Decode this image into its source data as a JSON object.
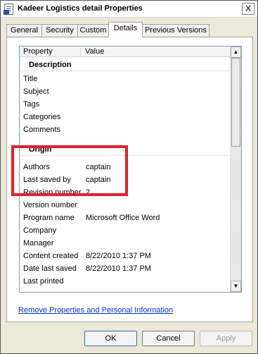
{
  "window": {
    "title": "Kadeer Logistics detail Properties",
    "close_glyph": "X"
  },
  "tabs": [
    {
      "label": "General",
      "active": false
    },
    {
      "label": "Security",
      "active": false
    },
    {
      "label": "Custom",
      "active": false
    },
    {
      "label": "Details",
      "active": true
    },
    {
      "label": "Previous Versions",
      "active": false
    }
  ],
  "grid": {
    "headers": {
      "property": "Property",
      "value": "Value"
    },
    "rows": [
      {
        "type": "section",
        "property": "Description",
        "value": ""
      },
      {
        "type": "item",
        "property": "Title",
        "value": ""
      },
      {
        "type": "item",
        "property": "Subject",
        "value": ""
      },
      {
        "type": "item",
        "property": "Tags",
        "value": ""
      },
      {
        "type": "item",
        "property": "Categories",
        "value": ""
      },
      {
        "type": "item",
        "property": "Comments",
        "value": ""
      },
      {
        "type": "section",
        "property": "Origin",
        "value": ""
      },
      {
        "type": "item",
        "property": "Authors",
        "value": "captain"
      },
      {
        "type": "item",
        "property": "Last saved by",
        "value": "captain"
      },
      {
        "type": "item",
        "property": "Revision number",
        "value": "2"
      },
      {
        "type": "item",
        "property": "Version number",
        "value": ""
      },
      {
        "type": "item",
        "property": "Program name",
        "value": "Microsoft Office Word"
      },
      {
        "type": "item",
        "property": "Company",
        "value": ""
      },
      {
        "type": "item",
        "property": "Manager",
        "value": ""
      },
      {
        "type": "item",
        "property": "Content created",
        "value": "8/22/2010 1:37 PM"
      },
      {
        "type": "item",
        "property": "Date last saved",
        "value": "8/22/2010 1:37 PM"
      },
      {
        "type": "item",
        "property": "Last printed",
        "value": ""
      }
    ]
  },
  "link_text": "Remove Properties and Personal Information",
  "buttons": {
    "ok": "OK",
    "cancel": "Cancel",
    "apply": "Apply"
  },
  "colors": {
    "highlight": "#e0202a",
    "link": "#0033cc"
  }
}
